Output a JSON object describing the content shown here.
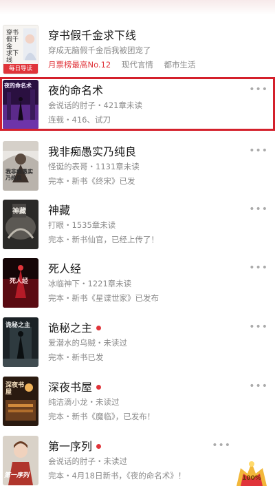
{
  "books": [
    {
      "title": "穿书假千金求下线",
      "line2": "穿成无脑假千金后我被团宠了",
      "tags": [
        "月票榜最高No.12",
        "现代言情",
        "都市生活"
      ],
      "cover_label": "每日导读",
      "cover_text": "穿书\n假千金\n求下线"
    },
    {
      "title": "夜的命名术",
      "line2": "会说话的肘子・421章未读",
      "line3": "连载・416、试刀",
      "cover_text": "夜的命名术"
    },
    {
      "title": "我非痴愚实乃纯良",
      "line2": "怪诞的表哥・1131章未读",
      "line3": "完本・新书《终宋》已发",
      "cover_text": "我非痴愚实乃纯良"
    },
    {
      "title": "神藏",
      "line2": "打眼・1535章未读",
      "line3": "完本・新书仙官，已经上传了！",
      "cover_text": "神藏"
    },
    {
      "title": "死人经",
      "line2": "冰临神下・1221章未读",
      "line3": "完本・新书《星谍世家》已发布",
      "cover_text": "死人经"
    },
    {
      "title": "诡秘之主",
      "line2": "爱潜水的乌贼・未读过",
      "line3": "完本・新书已发",
      "cover_text": "诡秘之主",
      "dot": true
    },
    {
      "title": "深夜书屋",
      "line2": "纯洁滴小龙・未读过",
      "line3": "完本・新书《魔临》，已发布！",
      "cover_text": "深夜书屋",
      "dot": true
    },
    {
      "title": "第一序列",
      "line2": "会说话的肘子・未读过",
      "line3": "完本・4月18日新书，《夜的命名术》！",
      "cover_text": "第一序列",
      "dot": true
    }
  ],
  "more_label": "•••",
  "badge_text": "100%"
}
